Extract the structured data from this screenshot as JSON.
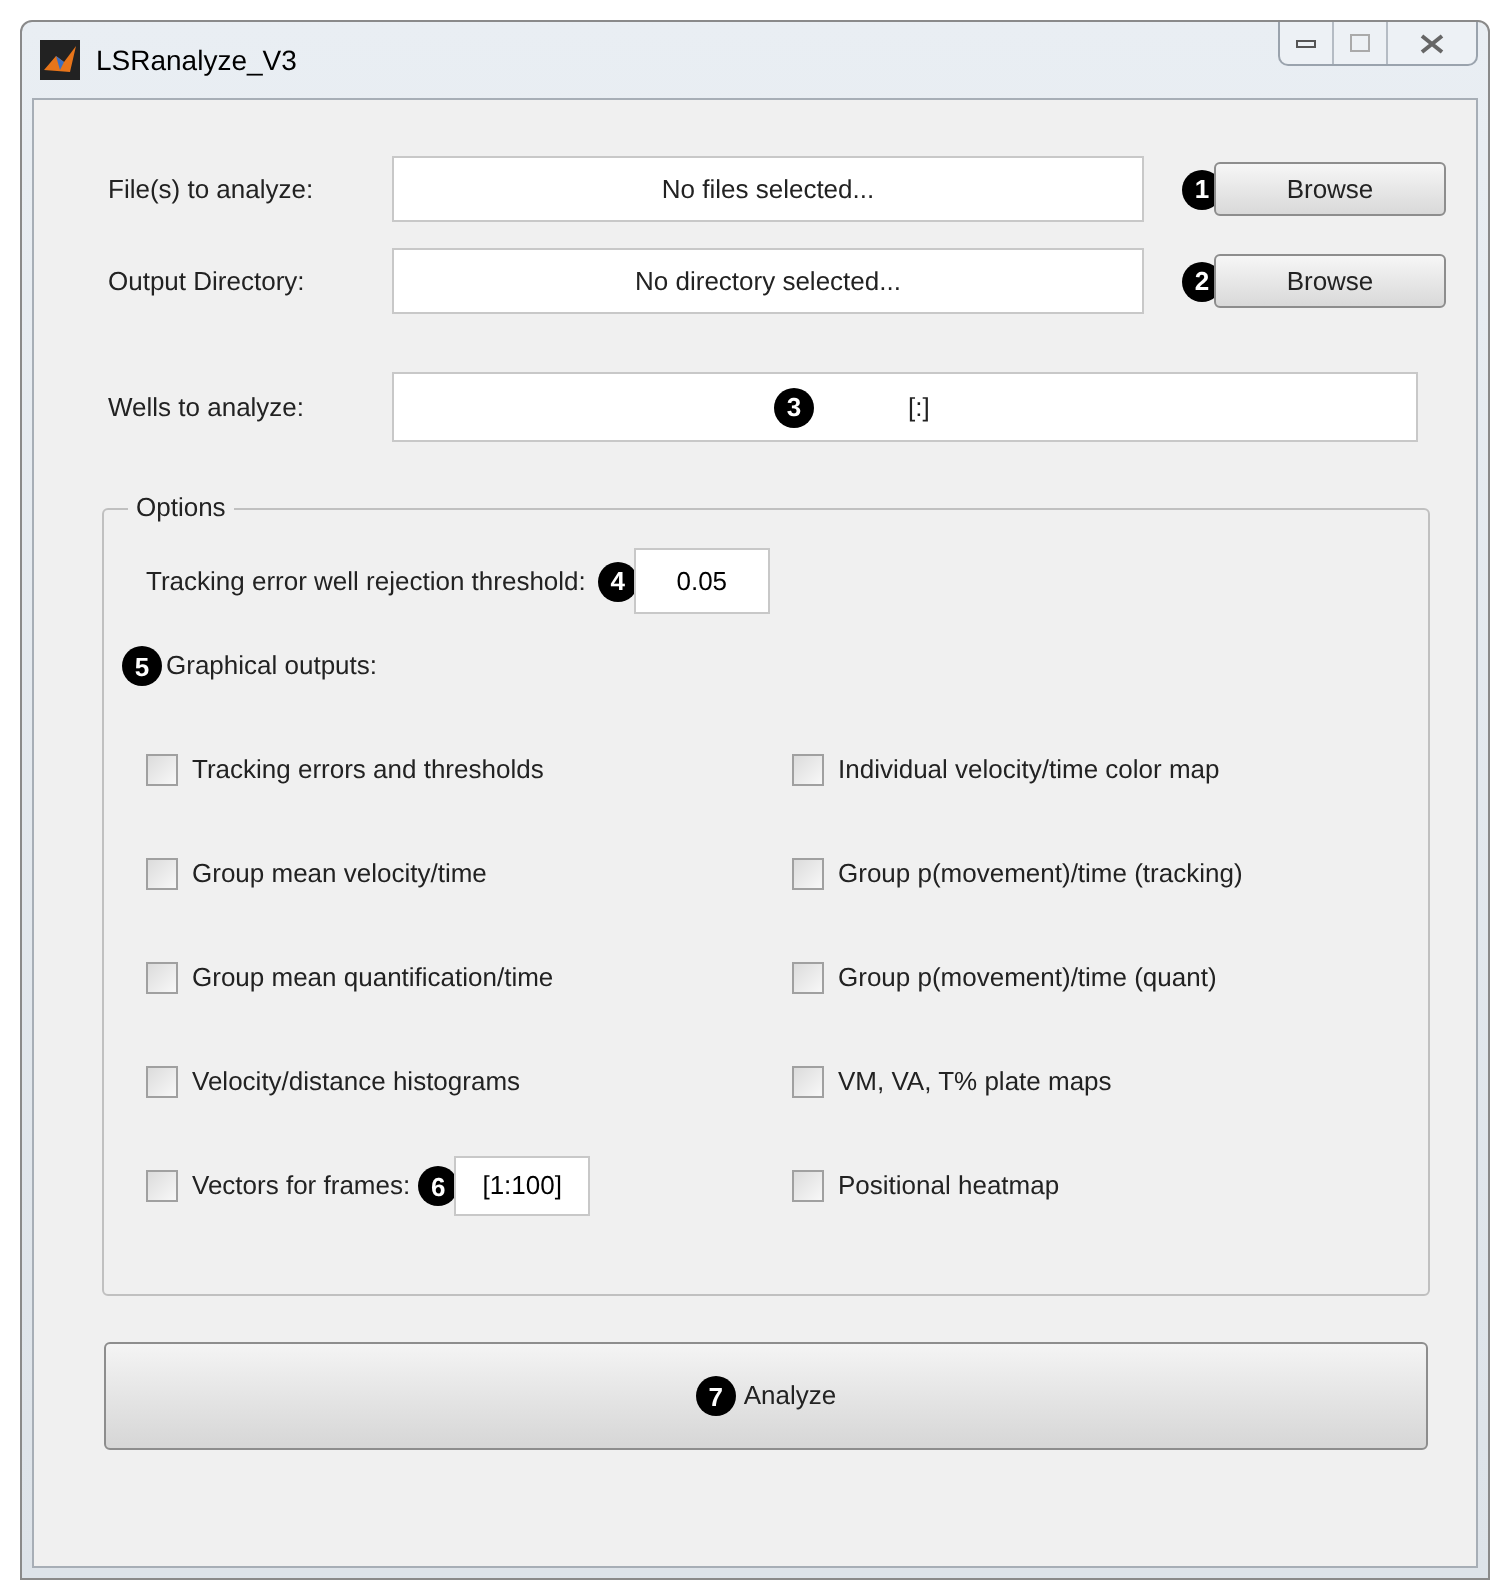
{
  "window": {
    "title": "LSRanalyze_V3"
  },
  "inputs": [
    {
      "label": "File(s) to analyze:",
      "value": "No files selected...",
      "callout": "1",
      "button": "Browse"
    },
    {
      "label": "Output Directory:",
      "value": "No directory selected...",
      "callout": "2",
      "button": "Browse"
    }
  ],
  "wells": {
    "label": "Wells to analyze:",
    "value": "[:]",
    "callout": "3"
  },
  "options": {
    "title": "Options",
    "threshold": {
      "label": "Tracking error well rejection threshold:",
      "value": "0.05",
      "callout": "4"
    },
    "graphical_outputs": {
      "label": "Graphical outputs:",
      "callout": "5"
    },
    "left_checkboxes": [
      {
        "label": "Tracking errors and thresholds",
        "checked": false
      },
      {
        "label": "Group mean velocity/time",
        "checked": false
      },
      {
        "label": "Group mean quantification/time",
        "checked": false
      },
      {
        "label": "Velocity/distance histograms",
        "checked": false
      },
      {
        "label": "Vectors for frames:",
        "checked": false,
        "field": {
          "value": "[1:100]",
          "callout": "6"
        }
      }
    ],
    "right_checkboxes": [
      {
        "label": "Individual velocity/time color map",
        "checked": false
      },
      {
        "label": "Group p(movement)/time (tracking)",
        "checked": false
      },
      {
        "label": "Group p(movement)/time (quant)",
        "checked": false
      },
      {
        "label": "VM, VA, T% plate maps",
        "checked": false
      },
      {
        "label": "Positional heatmap",
        "checked": false
      }
    ]
  },
  "analyze": {
    "label": "Analyze",
    "callout": "7"
  }
}
